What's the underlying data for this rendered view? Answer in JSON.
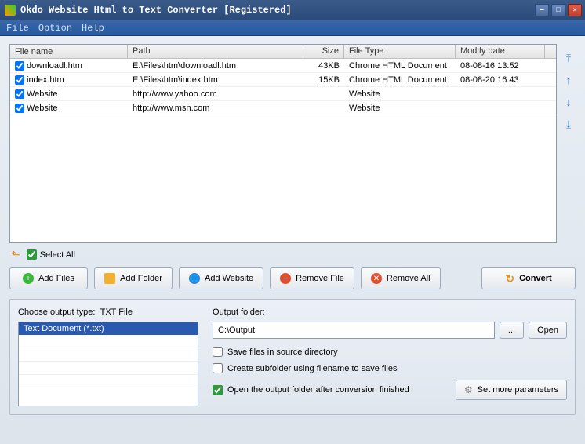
{
  "titlebar": {
    "text": "Okdo Website Html to Text Converter [Registered]"
  },
  "menu": {
    "file": "File",
    "option": "Option",
    "help": "Help"
  },
  "table": {
    "headers": {
      "name": "File name",
      "path": "Path",
      "size": "Size",
      "type": "File Type",
      "date": "Modify date"
    },
    "rows": [
      {
        "name": "downloadl.htm",
        "path": "E:\\Files\\htm\\downloadl.htm",
        "size": "43KB",
        "type": "Chrome HTML Document",
        "date": "08-08-16 13:52"
      },
      {
        "name": "index.htm",
        "path": "E:\\Files\\htm\\index.htm",
        "size": "15KB",
        "type": "Chrome HTML Document",
        "date": "08-08-20 16:43"
      },
      {
        "name": "Website",
        "path": "http://www.yahoo.com",
        "size": "",
        "type": "Website",
        "date": ""
      },
      {
        "name": "Website",
        "path": "http://www.msn.com",
        "size": "",
        "type": "Website",
        "date": ""
      }
    ]
  },
  "selectAll": "Select All",
  "buttons": {
    "addFiles": "Add Files",
    "addFolder": "Add Folder",
    "addWebsite": "Add Website",
    "removeFile": "Remove File",
    "removeAll": "Remove All",
    "convert": "Convert"
  },
  "output": {
    "chooseTypeLabel": "Choose output type:",
    "typeValue": "TXT File",
    "listItem": "Text Document (*.txt)",
    "folderLabel": "Output folder:",
    "folderValue": "C:\\Output",
    "browse": "...",
    "open": "Open",
    "saveSource": "Save files in source directory",
    "createSubfolder": "Create subfolder using filename to save files",
    "openAfter": "Open the output folder after conversion finished",
    "moreParams": "Set more parameters"
  }
}
